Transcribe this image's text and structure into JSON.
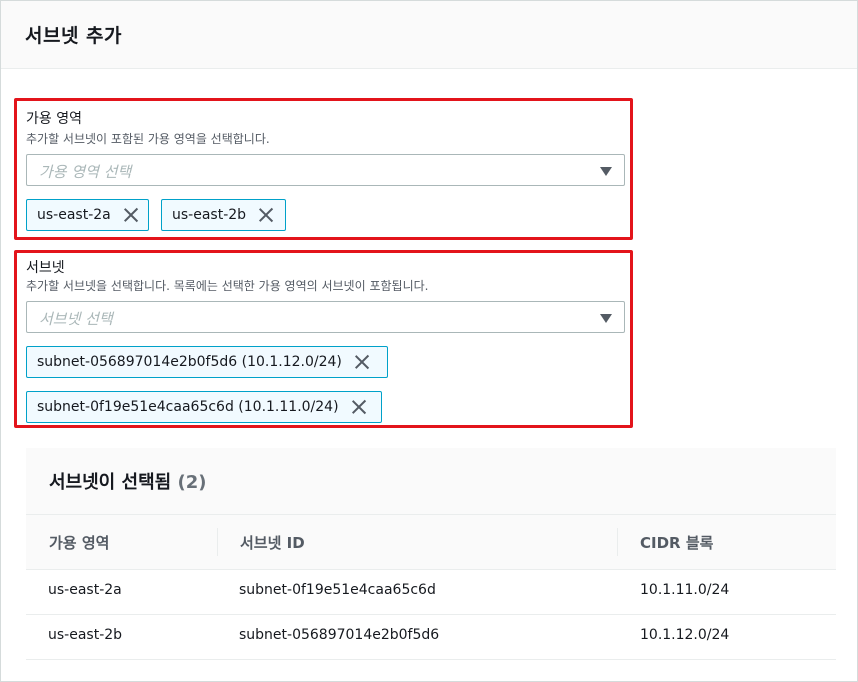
{
  "header": {
    "title": "서브넷 추가"
  },
  "availability_zones": {
    "label": "가용 영역",
    "description": "추가할 서브넷이 포함된 가용 영역을 선택합니다.",
    "placeholder": "가용 영역 선택",
    "tokens": [
      "us-east-2a",
      "us-east-2b"
    ]
  },
  "subnets": {
    "label": "서브넷",
    "description": "추가할 서브넷을 선택합니다. 목록에는 선택한 가용 영역의 서브넷이 포함됩니다.",
    "placeholder": "서브넷 선택",
    "tokens": [
      "subnet-056897014e2b0f5d6 (10.1.12.0/24)",
      "subnet-0f19e51e4caa65c6d (10.1.11.0/24)"
    ]
  },
  "selected_table": {
    "title": "서브넷이 선택됨",
    "count": "(2)",
    "columns": [
      "가용 영역",
      "서브넷 ID",
      "CIDR 블록"
    ],
    "rows": [
      [
        "us-east-2a",
        "subnet-0f19e51e4caa65c6d",
        "10.1.11.0/24"
      ],
      [
        "us-east-2b",
        "subnet-056897014e2b0f5d6",
        "10.1.12.0/24"
      ]
    ]
  },
  "colors": {
    "highlight": "#e3141b",
    "token_border": "#00a1c9",
    "token_bg": "#f1faff"
  }
}
